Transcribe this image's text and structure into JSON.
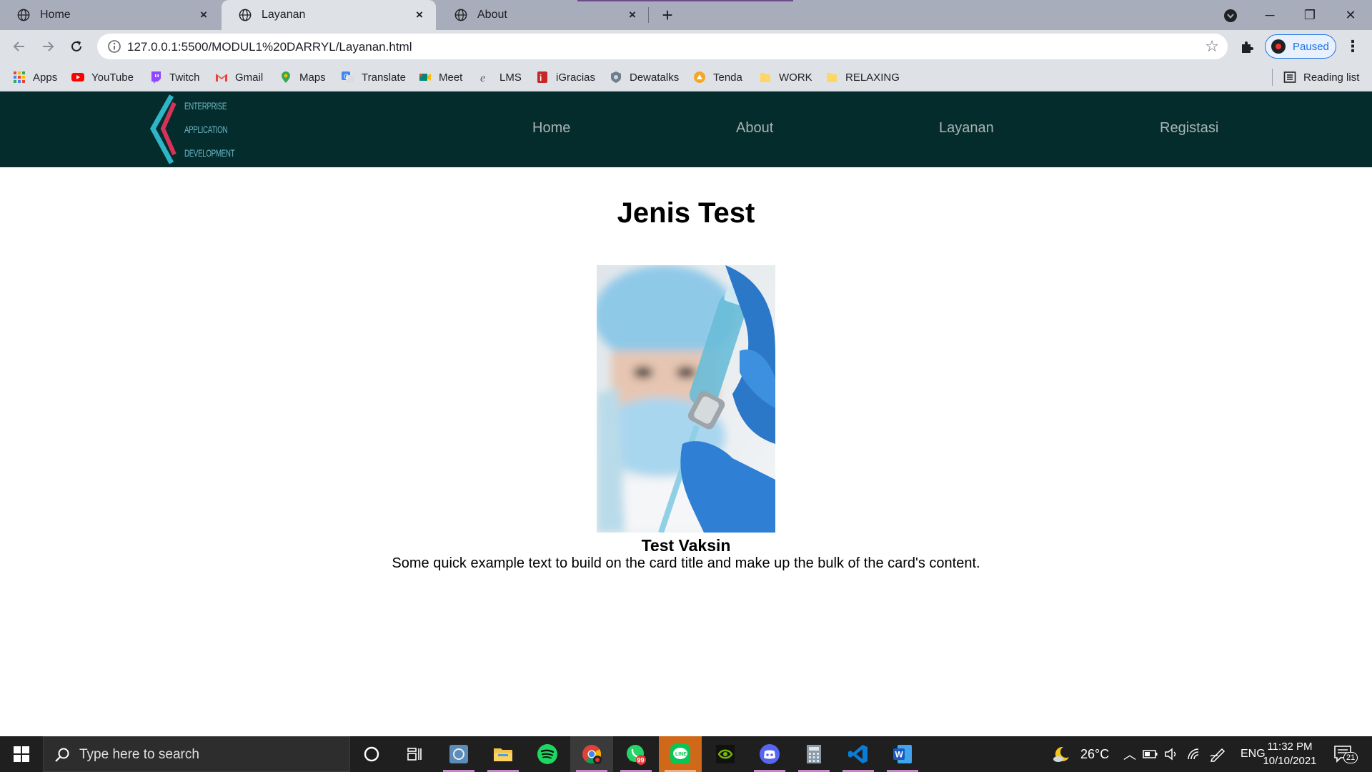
{
  "browser": {
    "tabs": [
      {
        "title": "Home",
        "active": false
      },
      {
        "title": "Layanan",
        "active": true
      },
      {
        "title": "About",
        "active": false
      }
    ],
    "new_tab_label": "+",
    "window_controls": {
      "minimize": "─",
      "restore": "❐",
      "close": "✕"
    },
    "address": "127.0.0.1:5500/MODUL1%20DARRYL/Layanan.html",
    "profile_label": "Paused",
    "reading_list_label": "Reading list",
    "bookmarks": [
      {
        "label": "Apps",
        "icon": "apps-grid-icon"
      },
      {
        "label": "YouTube",
        "icon": "youtube-icon"
      },
      {
        "label": "Twitch",
        "icon": "twitch-icon"
      },
      {
        "label": "Gmail",
        "icon": "gmail-icon"
      },
      {
        "label": "Maps",
        "icon": "maps-icon"
      },
      {
        "label": "Translate",
        "icon": "translate-icon"
      },
      {
        "label": "Meet",
        "icon": "meet-icon"
      },
      {
        "label": "LMS",
        "icon": "lms-icon"
      },
      {
        "label": "iGracias",
        "icon": "igracias-icon"
      },
      {
        "label": "Dewatalks",
        "icon": "dewatalks-icon"
      },
      {
        "label": "Tenda",
        "icon": "tenda-icon"
      },
      {
        "label": "WORK",
        "icon": "folder-icon"
      },
      {
        "label": "RELAXING",
        "icon": "folder-icon"
      }
    ]
  },
  "site": {
    "logo_words": [
      "ENTERPRISE",
      "APPLICATION",
      "DEVELOPMENT"
    ],
    "nav": [
      {
        "label": "Home"
      },
      {
        "label": "About"
      },
      {
        "label": "Layanan"
      },
      {
        "label": "Registasi"
      }
    ],
    "heading": "Jenis Test",
    "card": {
      "title": "Test Vaksin",
      "text": "Some quick example text to build on the card title and make up the bulk of the card's content.",
      "image_subject": "health worker in mask and gloves holding vaccine vial"
    }
  },
  "taskbar": {
    "search_placeholder": "Type here to search",
    "weather": "26°C",
    "language": "ENG",
    "time": "11:32 PM",
    "date": "10/10/2021",
    "whatsapp_badge": "99",
    "notification_count": "21",
    "pinned_apps": [
      "task-view",
      "app-unknown",
      "file-explorer",
      "spotify",
      "chrome",
      "whatsapp",
      "line",
      "nvidia",
      "discord",
      "calculator",
      "vscode",
      "word"
    ]
  },
  "colors": {
    "tabstrip": "#a8adbb",
    "toolbar": "#dee1e6",
    "site_nav": "#052c2c",
    "site_nav_text": "#a9b4b4",
    "taskbar": "#1f1f1f"
  }
}
